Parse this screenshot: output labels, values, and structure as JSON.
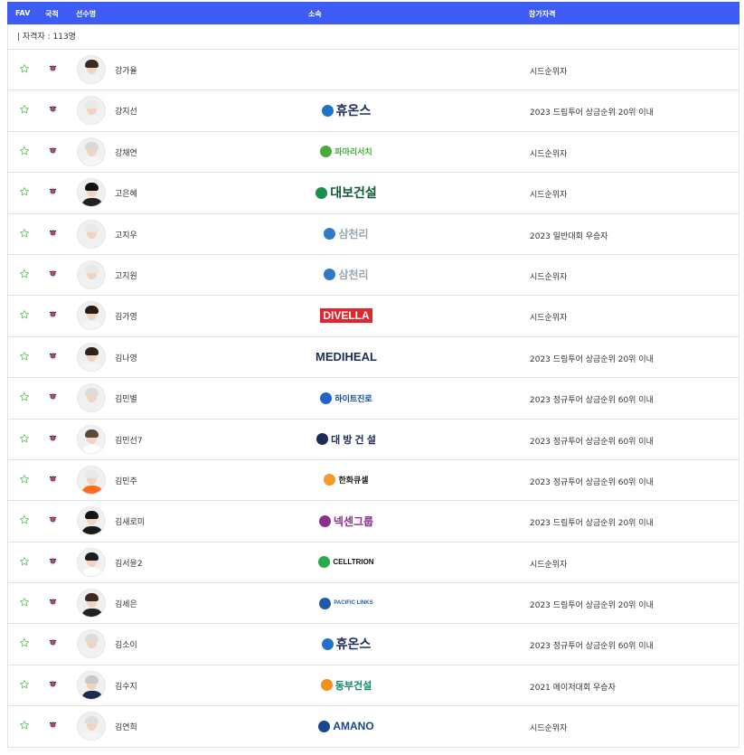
{
  "header": {
    "fav": "FAV",
    "nationality": "국적",
    "player": "선수명",
    "affiliation": "소속",
    "qualification": "참가자격"
  },
  "count_text": "| 자격자 : 113명",
  "colors": {
    "header_bg": "#3d5bf5",
    "star": "#5cc95c",
    "border": "#e3e3e3"
  },
  "rows": [
    {
      "name": "강가율",
      "sponsor": "",
      "qualification": "시드순위자"
    },
    {
      "name": "강지선",
      "sponsor": "휴온스",
      "qualification": "2023 드림투어 상금순위 20위 이내"
    },
    {
      "name": "강채연",
      "sponsor": "파마리서치",
      "qualification": "시드순위자"
    },
    {
      "name": "고은혜",
      "sponsor": "대보건설",
      "qualification": "시드순위자"
    },
    {
      "name": "고지우",
      "sponsor": "삼천리",
      "qualification": "2023 일반대회 우승자"
    },
    {
      "name": "고지원",
      "sponsor": "삼천리",
      "qualification": "시드순위자"
    },
    {
      "name": "김가영",
      "sponsor": "DIVELLA",
      "qualification": "시드순위자"
    },
    {
      "name": "김나영",
      "sponsor": "MEDIHEAL",
      "qualification": "2023 드림투어 상금순위 20위 이내"
    },
    {
      "name": "김민별",
      "sponsor": "하이트진로",
      "qualification": "2023 정규투어 상금순위 60위 이내"
    },
    {
      "name": "김민선7",
      "sponsor": "대 방 건 설",
      "qualification": "2023 정규투어 상금순위 60위 이내"
    },
    {
      "name": "김민주",
      "sponsor": "한화큐셀",
      "qualification": "2023 정규투어 상금순위 60위 이내"
    },
    {
      "name": "김새로미",
      "sponsor": "넥센그룹",
      "qualification": "2023 드림투어 상금순위 20위 이내"
    },
    {
      "name": "김서윤2",
      "sponsor": "CELLTRION",
      "qualification": "시드순위자"
    },
    {
      "name": "김세은",
      "sponsor": "PACIFIC LINKS",
      "qualification": "2023 드림투어 상금순위 20위 이내"
    },
    {
      "name": "김소이",
      "sponsor": "휴온스",
      "qualification": "2023 정규투어 상금순위 60위 이내"
    },
    {
      "name": "김수지",
      "sponsor": "동부건설",
      "qualification": "2021 메이저대회 우승자"
    },
    {
      "name": "김연희",
      "sponsor": "AMANO",
      "qualification": "시드순위자"
    }
  ]
}
